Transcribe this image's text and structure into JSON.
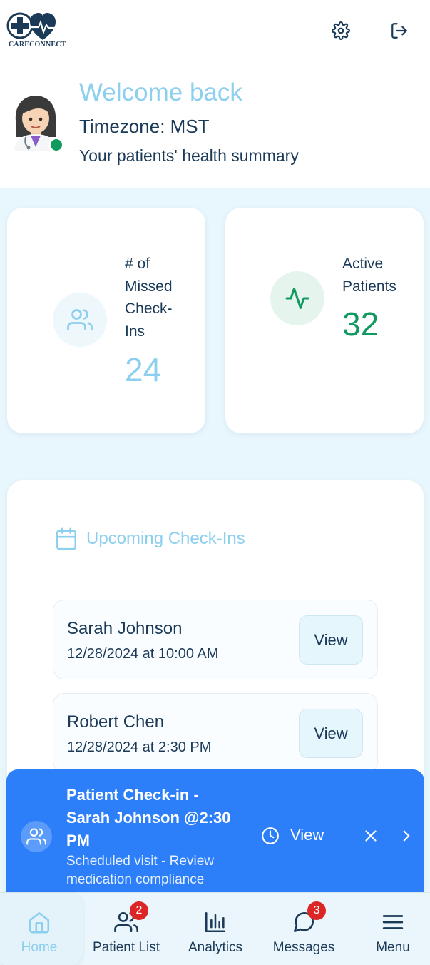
{
  "app": {
    "logo_text": "CARECONNECT"
  },
  "header": {
    "welcome": "Welcome back",
    "timezone": "Timezone: MST",
    "summary": "Your patients' health summary",
    "settings_icon": "gear-icon",
    "logout_icon": "logout-icon",
    "status_color": "#119a5f"
  },
  "stats": [
    {
      "label": "# of Missed Check-Ins",
      "value": "24",
      "icon": "users-icon",
      "color": "#8ccfee"
    },
    {
      "label": "Active Patients",
      "value": "32",
      "icon": "activity-icon",
      "color": "#119a5f"
    }
  ],
  "upcoming": {
    "title": "Upcoming Check-Ins",
    "icon": "calendar-icon",
    "items": [
      {
        "name": "Sarah Johnson",
        "time": "12/28/2024 at 10:00 AM",
        "action": "View"
      },
      {
        "name": "Robert Chen",
        "time": "12/28/2024 at 2:30 PM",
        "action": "View"
      }
    ]
  },
  "notification": {
    "title": "Patient Check-in - Sarah Johnson @2:30 PM",
    "subtitle": "Scheduled visit - Review medication compliance",
    "action": "View",
    "color": "#2d7ff9"
  },
  "nav": {
    "items": [
      {
        "label": "Home",
        "icon": "home-icon",
        "badge": ""
      },
      {
        "label": "Patient List",
        "icon": "users-icon",
        "badge": "2"
      },
      {
        "label": "Analytics",
        "icon": "bar-chart-icon",
        "badge": ""
      },
      {
        "label": "Messages",
        "icon": "message-icon",
        "badge": "3"
      },
      {
        "label": "Menu",
        "icon": "menu-icon",
        "badge": ""
      }
    ]
  }
}
